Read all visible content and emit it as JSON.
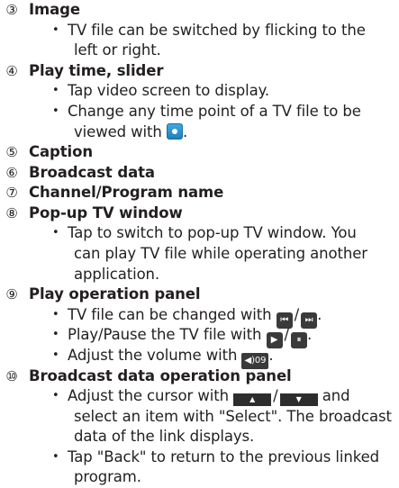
{
  "items": [
    {
      "num": "③",
      "title": "Image"
    },
    {
      "num": "④",
      "title": "Play time, slider"
    },
    {
      "num": "⑤",
      "title": "Caption"
    },
    {
      "num": "⑥",
      "title": "Broadcast data"
    },
    {
      "num": "⑦",
      "title": "Channel/Program name"
    },
    {
      "num": "⑧",
      "title": "Pop-up TV window"
    },
    {
      "num": "⑨",
      "title": "Play operation panel"
    },
    {
      "num": "⑩",
      "title": "Broadcast data operation panel"
    }
  ],
  "bullet_char": "•",
  "text": {
    "image_b1_l1": "TV file can be switched by flicking to the",
    "image_b1_l2": "left or right.",
    "play_b1": "Tap video screen to display.",
    "play_b2_l1": "Change any time point of a TV file to be",
    "play_b2_l2a": "viewed with",
    "play_b2_l2b": ".",
    "popup_b1_l1": "Tap to switch to pop-up TV window. You",
    "popup_b1_l2": "can play TV file while operating another",
    "popup_b1_l3": "application.",
    "panel_b1a": "TV file can be changed with",
    "panel_b1b": "/",
    "panel_b1c": ".",
    "panel_b2a": "Play/Pause the TV file with",
    "panel_b2b": "/",
    "panel_b2c": ".",
    "panel_b3a": "Adjust the volume with",
    "panel_b3b": ".",
    "bd_b1_l1a": "Adjust the cursor with",
    "bd_b1_l1b": "/",
    "bd_b1_l1c": "and",
    "bd_b1_l2": "select an item with \"Select\". The broadcast",
    "bd_b1_l3": "data of the link displays.",
    "bd_b2_l1": "Tap \"Back\" to return to the previous linked",
    "bd_b2_l2": "program."
  },
  "icons": {
    "prev_glyph": "⏮",
    "next_glyph": "⏭",
    "play_glyph": "▶",
    "pause_glyph": "⏸",
    "volume_label": "◀)09",
    "up_glyph": "▲",
    "down_glyph": "▼"
  }
}
